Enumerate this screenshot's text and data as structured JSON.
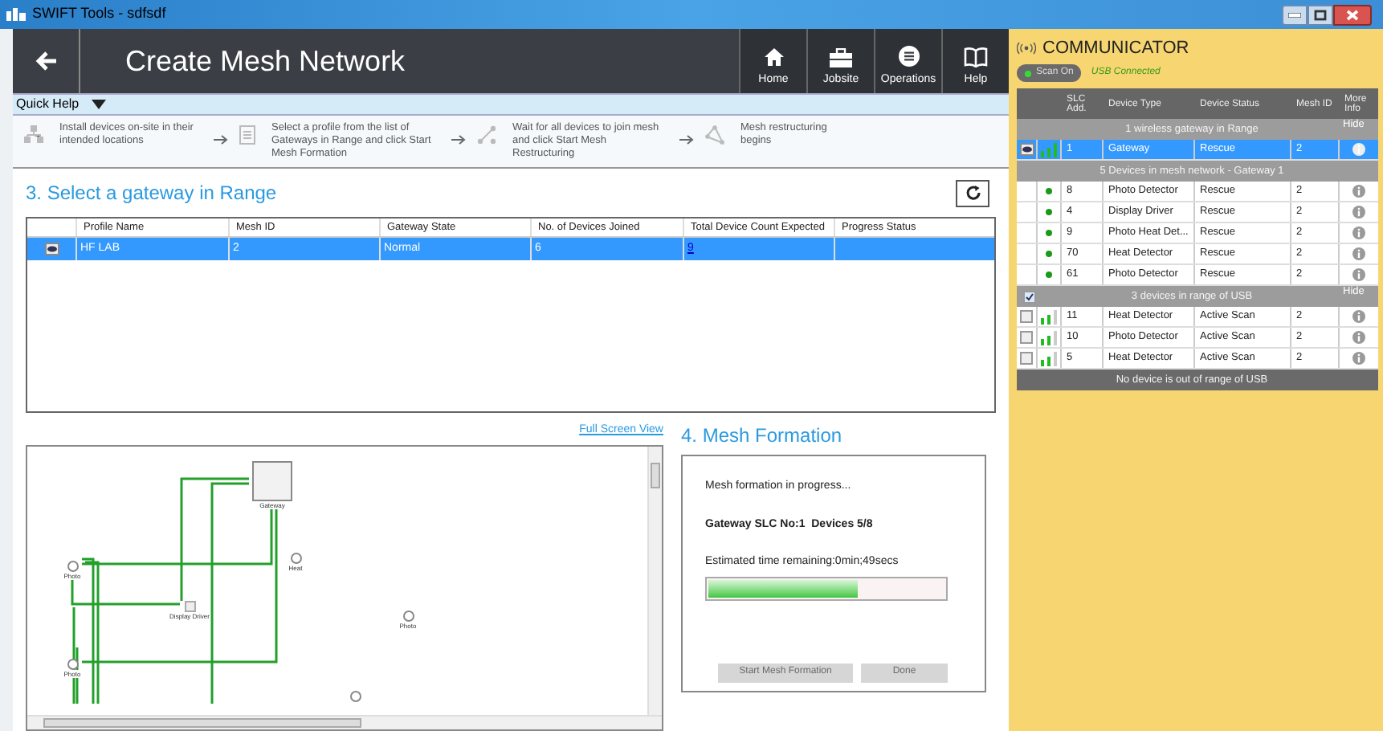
{
  "window": {
    "title": "SWIFT Tools - sdfsdf"
  },
  "header": {
    "title": "Create Mesh Network",
    "nav": [
      {
        "kind": "home",
        "label": "Home"
      },
      {
        "kind": "jobsite",
        "label": "Jobsite"
      },
      {
        "kind": "operations",
        "label": "Operations"
      },
      {
        "kind": "help",
        "label": "Help"
      }
    ]
  },
  "quick_help": {
    "label": "Quick Help",
    "steps": [
      {
        "kind": "install",
        "text": "Install devices on-site in their intended locations"
      },
      {
        "kind": "select",
        "text": "Select a profile from the list of Gateways in Range and click Start Mesh Formation"
      },
      {
        "kind": "wait",
        "text": "Wait for all devices to join mesh and click Start Mesh Restructuring"
      },
      {
        "kind": "restructure",
        "text": "Mesh restructuring begins"
      }
    ]
  },
  "gateway_section": {
    "heading": "3. Select a gateway in Range",
    "table": {
      "columns": [
        "Profile Name",
        "Mesh ID",
        "Gateway State",
        "No. of Devices Joined",
        "Total Device Count Expected",
        "Progress Status"
      ],
      "rows": [
        {
          "selected": true,
          "cells": [
            "HF LAB",
            "2",
            "Normal",
            "6",
            "9",
            ""
          ]
        }
      ]
    }
  },
  "diagram": {
    "link": "Full Screen View",
    "nodes": [
      {
        "kind": "gateway",
        "label": "Gateway"
      },
      {
        "kind": "device",
        "label": "Heat"
      },
      {
        "kind": "device",
        "label": "Photo"
      },
      {
        "kind": "driver",
        "label": "Display Driver"
      },
      {
        "kind": "device",
        "label": "Photo"
      },
      {
        "kind": "device",
        "label": "Photo"
      },
      {
        "kind": "device"
      }
    ]
  },
  "mesh_formation": {
    "heading": "4. Mesh Formation",
    "status": "Mesh formation in progress...",
    "gateway_line": "Gateway SLC No:1  Devices 5/8",
    "time_remaining": "Estimated time remaining:0min;49secs",
    "progress": {
      "level": 0.63
    },
    "buttons": [
      {
        "label": "Start Mesh Formation",
        "disabled": true
      },
      {
        "label": "Done",
        "disabled": true
      }
    ]
  },
  "communicator": {
    "title": "COMMUNICATOR",
    "scan": {
      "label": "Scan On",
      "on": true
    },
    "usb_status": "USB Connected",
    "columns": [
      "SLC Add.",
      "Device Type",
      "Device Status",
      "Mesh ID",
      "More Info"
    ],
    "groups": [
      {
        "header": "1 wireless gateway in Range",
        "toggle": "Hide",
        "rows": [
          {
            "kind": "gateway",
            "selected": true,
            "slc": "1",
            "type": "Gateway",
            "status": "Rescue",
            "mesh_id": "2"
          }
        ]
      },
      {
        "header": "5 Devices in mesh network - Gateway 1",
        "rows": [
          {
            "kind": "mesh",
            "selected": false,
            "slc": "8",
            "type": "Photo Detector",
            "status": "Rescue",
            "mesh_id": "2"
          },
          {
            "kind": "mesh",
            "selected": false,
            "slc": "4",
            "type": "Display Driver",
            "status": "Rescue",
            "mesh_id": "2"
          },
          {
            "kind": "mesh",
            "selected": false,
            "slc": "9",
            "type": "Photo Heat Det...",
            "status": "Rescue",
            "mesh_id": "2"
          },
          {
            "kind": "mesh",
            "selected": false,
            "slc": "70",
            "type": "Heat Detector",
            "status": "Rescue",
            "mesh_id": "2"
          },
          {
            "kind": "mesh",
            "selected": false,
            "slc": "61",
            "type": "Photo Detector",
            "status": "Rescue",
            "mesh_id": "2"
          }
        ]
      },
      {
        "header": "3 devices in range of USB",
        "toggle": "Hide",
        "checked": true,
        "rows": [
          {
            "kind": "usb",
            "selected": false,
            "checked": false,
            "slc": "11",
            "type": "Heat Detector",
            "status": "Active Scan",
            "mesh_id": "2"
          },
          {
            "kind": "usb",
            "selected": false,
            "checked": false,
            "slc": "10",
            "type": "Photo Detector",
            "status": "Active Scan",
            "mesh_id": "2"
          },
          {
            "kind": "usb",
            "selected": false,
            "checked": false,
            "slc": "5",
            "type": "Heat Detector",
            "status": "Active Scan",
            "mesh_id": "2"
          }
        ]
      },
      {
        "header": "No device is out of range of USB"
      }
    ]
  }
}
